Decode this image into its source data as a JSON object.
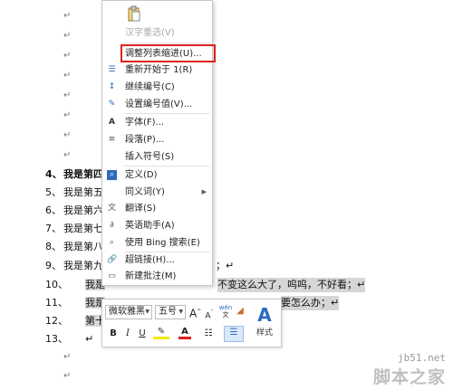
{
  "paragraph_mark": "↵",
  "document": {
    "list_lines": [
      {
        "num": "4、",
        "text": "我是第四",
        "bold": true
      },
      {
        "num": "5、",
        "text": "我是第五"
      },
      {
        "num": "6、",
        "text": "我是第六"
      },
      {
        "num": "7、",
        "text": "我是第七"
      },
      {
        "num": "8、",
        "text": "我是第八"
      },
      {
        "num": "9、",
        "text": "我是第九",
        "tail": "；↵"
      },
      {
        "num": "10、",
        "text": "我是",
        "tail": "不变这么大了，呜呜，不好看；↵"
      },
      {
        "num": "11、",
        "text": "我是",
        "tail": "要怎么办；↵"
      },
      {
        "num": "12、",
        "text": "第十"
      },
      {
        "num": "13、",
        "text": "↵"
      }
    ]
  },
  "context_menu": {
    "items": [
      {
        "label": "汉字重选(V)",
        "icon": "",
        "disabled": true
      },
      {
        "label": "调整列表缩进(U)...",
        "icon": "",
        "highlighted": true
      },
      {
        "label": "重新开始于 1(R)",
        "icon": "restart-numbering-icon"
      },
      {
        "label": "继续编号(C)",
        "icon": "continue-numbering-icon"
      },
      {
        "label": "设置编号值(V)...",
        "icon": "set-numbering-value-icon"
      },
      {
        "label": "字体(F)...",
        "icon": "font-icon"
      },
      {
        "label": "段落(P)...",
        "icon": "paragraph-icon"
      },
      {
        "label": "插入符号(S)",
        "icon": ""
      },
      {
        "label": "定义(D)",
        "icon": "define-icon"
      },
      {
        "label": "同义词(Y)",
        "icon": "",
        "submenu": true
      },
      {
        "label": "翻译(S)",
        "icon": "translate-icon"
      },
      {
        "label": "英语助手(A)",
        "icon": "english-assistant-icon"
      },
      {
        "label": "使用 Bing 搜索(E)",
        "icon": "bing-search-icon"
      },
      {
        "label": "超链接(H)...",
        "icon": "hyperlink-icon"
      },
      {
        "label": "新建批注(M)",
        "icon": "new-comment-icon"
      }
    ]
  },
  "mini_toolbar": {
    "font_name": "微软雅黑",
    "font_size": "五号",
    "grow_font": "A",
    "shrink_font": "A",
    "phonetic": "wén",
    "bold": "B",
    "italic": "I",
    "underline": "U",
    "font_color_letter": "A",
    "style_label": "样式",
    "colors": {
      "highlight": "#f5e90a",
      "font_color": "#e02020",
      "accent": "#2a6bbf"
    }
  },
  "watermark": {
    "url": "jb51.net",
    "text": "脚本之家"
  }
}
